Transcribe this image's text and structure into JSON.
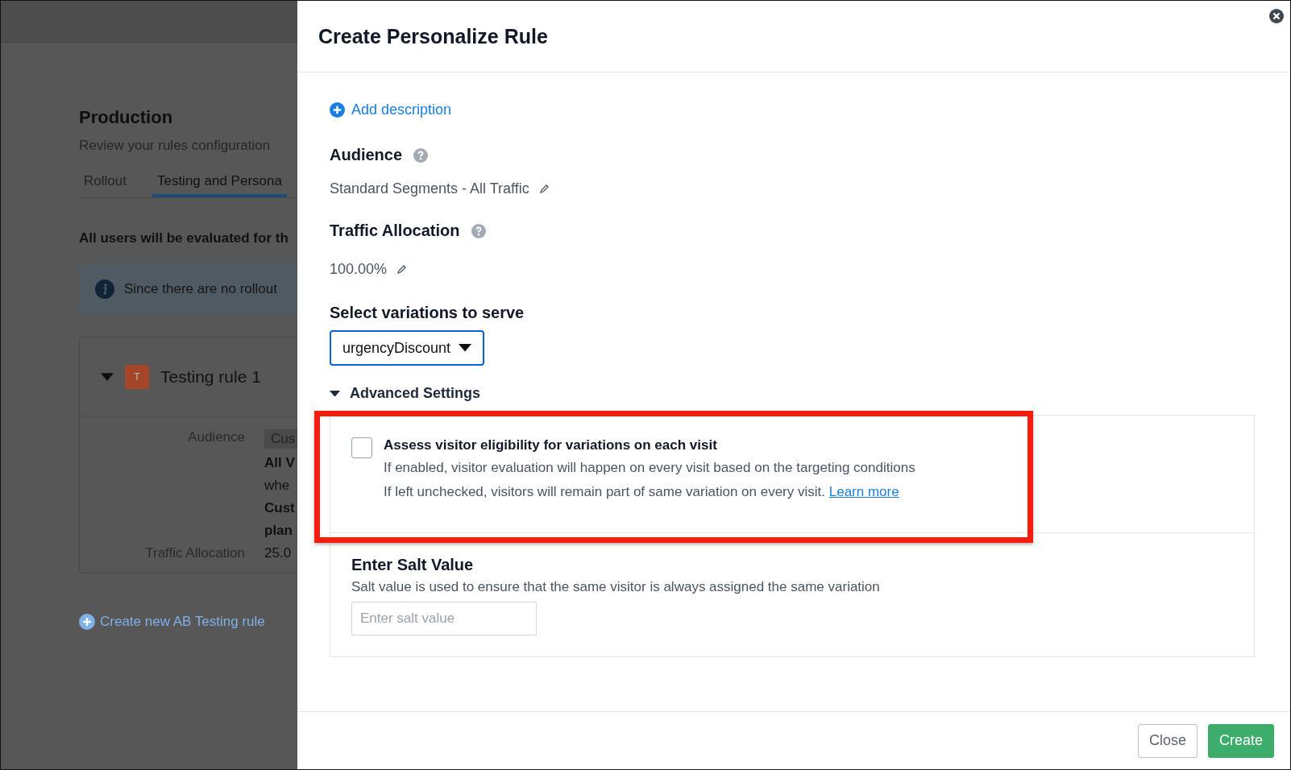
{
  "background": {
    "title": "Production",
    "subtitle": "Review your rules configuration",
    "tabs": [
      {
        "label": "Rollout",
        "selected": false
      },
      {
        "label": "Testing and Persona",
        "selected": true
      }
    ],
    "notice": "All users will be evaluated for th",
    "info": "Since there are no rollout",
    "rule": {
      "expanded": true,
      "badge": "T",
      "color": "#a5452a",
      "name": "Testing rule 1",
      "audience_label": "Audience",
      "audience_tag": "Cus",
      "audience_value": "All V",
      "where": "whe",
      "conditions": [
        "Cust",
        "plan"
      ],
      "traffic_label": "Traffic Allocation",
      "traffic_value": "25.0"
    },
    "create_link": "Create new AB Testing rule"
  },
  "modal": {
    "title": "Create Personalize Rule",
    "add_description": "Add description",
    "audience": {
      "heading": "Audience",
      "value": "Standard Segments - All Traffic"
    },
    "traffic": {
      "heading": "Traffic Allocation",
      "value": "100.00%"
    },
    "variations": {
      "heading": "Select variations to serve",
      "value": "urgencyDiscount"
    },
    "advanced": {
      "label": "Advanced Settings",
      "expanded": true
    },
    "eligibility": {
      "checked": false,
      "highlighted": true,
      "label": "Assess visitor eligibility for variations on each visit",
      "line_1": "If enabled, visitor evaluation will happen on every visit based on the targeting conditions",
      "line_2": "If left unchecked, visitors will remain part of same variation on every visit.",
      "link": "Learn more"
    },
    "salt": {
      "heading": "Enter Salt Value",
      "description": "Salt value is used to ensure that the same visitor is always assigned the same variation",
      "placeholder": "Enter salt value"
    },
    "buttons": [
      {
        "label": "Close",
        "kind": "secondary"
      },
      {
        "label": "Create",
        "kind": "primary"
      }
    ]
  }
}
